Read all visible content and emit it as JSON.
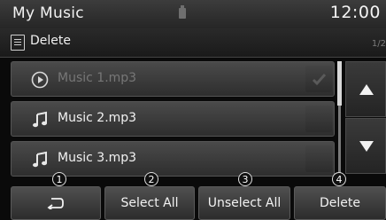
{
  "header": {
    "title": "My Music",
    "clock": "12:00"
  },
  "subheader": {
    "label": "Delete",
    "page": "1/2"
  },
  "list": {
    "items": [
      {
        "label": "Music 1.mp3",
        "icon": "play-circle-icon"
      },
      {
        "label": "Music 2.mp3",
        "icon": "music-note-icon"
      },
      {
        "label": "Music 3.mp3",
        "icon": "music-note-icon"
      }
    ]
  },
  "callouts": [
    "1",
    "2",
    "3",
    "4"
  ],
  "buttons": {
    "back_icon": "return-arrow-icon",
    "select_all": "Select All",
    "unselect_all": "Unselect All",
    "delete": "Delete"
  }
}
